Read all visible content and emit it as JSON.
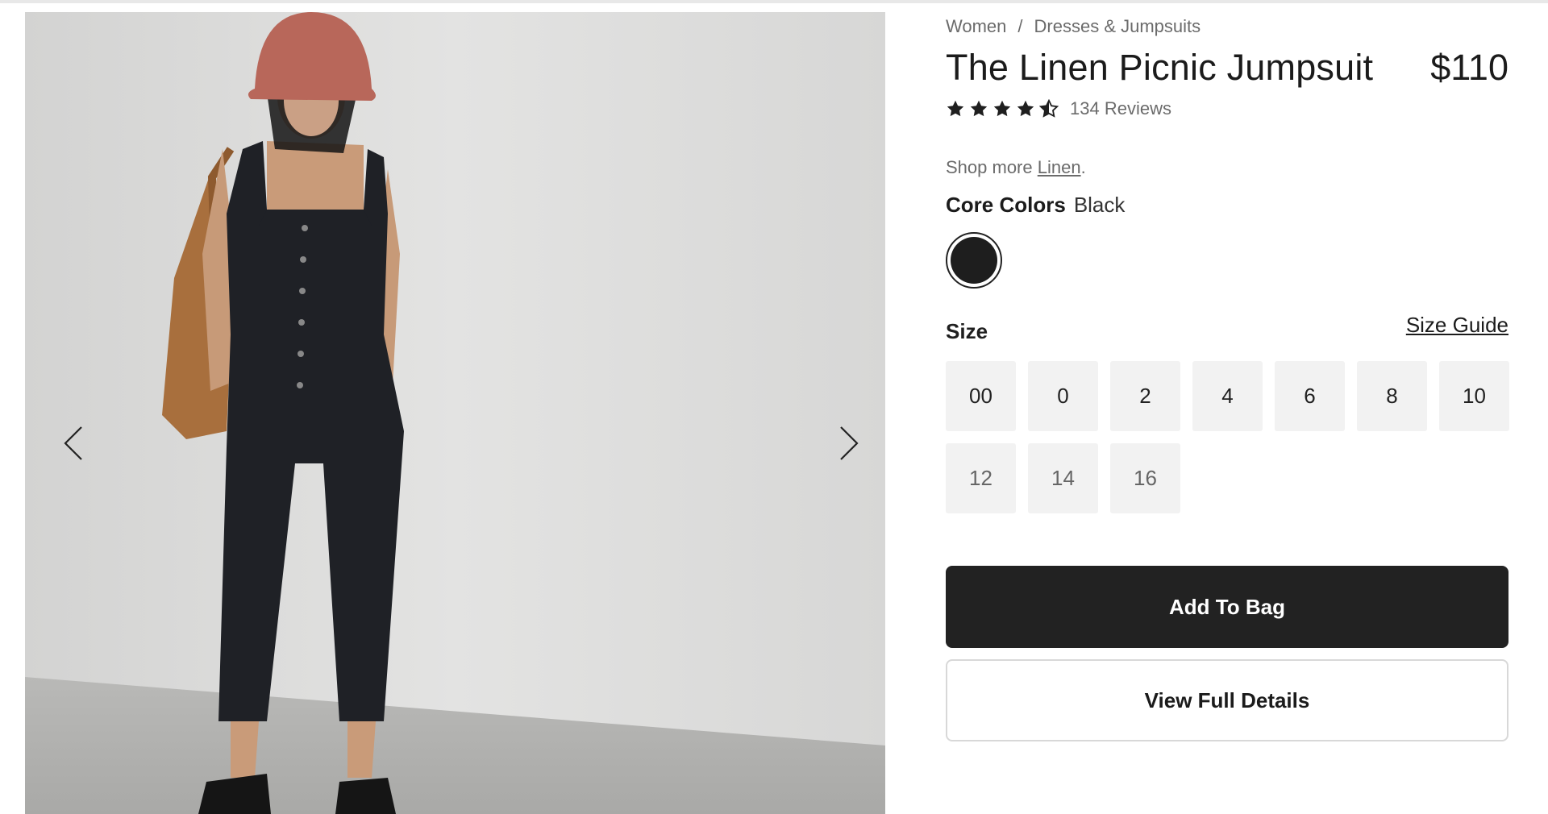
{
  "breadcrumb": {
    "items": [
      "Women",
      "Dresses & Jumpsuits"
    ],
    "separator": "/"
  },
  "product": {
    "title": "The Linen Picnic Jumpsuit",
    "price": "$110",
    "rating": 4.5,
    "reviews_label": "134 Reviews"
  },
  "shop_more": {
    "prefix": "Shop more ",
    "link": "Linen",
    "suffix": "."
  },
  "colors": {
    "label": "Core Colors",
    "selected": "Black",
    "swatches": [
      {
        "name": "Black",
        "hex": "#1e1e1e"
      }
    ]
  },
  "size": {
    "label": "Size",
    "guide_label": "Size Guide",
    "options": [
      "00",
      "0",
      "2",
      "4",
      "6",
      "8",
      "10",
      "12",
      "14",
      "16"
    ]
  },
  "actions": {
    "add_to_bag": "Add To Bag",
    "view_details": "View Full Details"
  },
  "gallery": {
    "prev_icon": "chevron-left-icon",
    "next_icon": "chevron-right-icon"
  },
  "theme": {
    "button_dark": "#222222",
    "size_bg": "#f2f2f2",
    "muted_text": "#6b6b6b"
  }
}
